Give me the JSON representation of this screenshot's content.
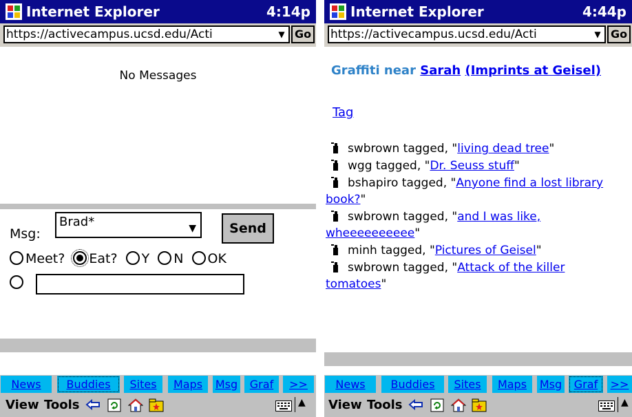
{
  "left_screen": {
    "title": "Internet Explorer",
    "clock": "4:14p",
    "url": "https://activecampus.ucsd.edu/Acti",
    "go_label": "Go",
    "status": "No Messages",
    "msg_label": "Msg:",
    "msg_recipient": "Brad*",
    "send_label": "Send",
    "radio_options": [
      {
        "label": "Meet?",
        "checked": false
      },
      {
        "label": "Eat?",
        "checked": true
      },
      {
        "label": "Y",
        "checked": false
      },
      {
        "label": "N",
        "checked": false
      },
      {
        "label": "OK",
        "checked": false
      }
    ],
    "nav": [
      "News",
      "Buddies",
      "Sites",
      "Maps",
      "Msg",
      "Graf",
      ">>"
    ],
    "nav_active": "Buddies",
    "menu": [
      "View",
      "Tools"
    ]
  },
  "right_screen": {
    "title": "Internet Explorer",
    "clock": "4:44p",
    "url": "https://activecampus.ucsd.edu/Acti",
    "go_label": "Go",
    "heading_prefix": "Graffiti near",
    "heading_person": "Sarah",
    "heading_place": "(Imprints at Geisel)",
    "tag_link": "Tag",
    "tags": [
      {
        "user": "swbrown",
        "text": "living dead tree"
      },
      {
        "user": "wgg",
        "text": "Dr. Seuss stuff"
      },
      {
        "user": "bshapiro",
        "text": "Anyone find a lost library book?"
      },
      {
        "user": "swbrown",
        "text": "and I was like, wheeeeeeeeee"
      },
      {
        "user": "minh",
        "text": "Pictures of Geisel"
      },
      {
        "user": "swbrown",
        "text": "Attack of the killer tomatoes"
      }
    ],
    "tagged_word": "tagged,",
    "nav": [
      "News",
      "Buddies",
      "Sites",
      "Maps",
      "Msg",
      "Graf",
      ">>"
    ],
    "nav_active": "Graf",
    "menu": [
      "View",
      "Tools"
    ]
  },
  "colors": {
    "titlebar": "#0a0a8c",
    "nav_tab": "#00b7ef",
    "link": "#0000ee",
    "heading": "#2e82c8",
    "chrome": "#c0c0c0"
  },
  "icons": [
    "windows-flag-icon",
    "dropdown-arrow-icon",
    "back-arrow-icon",
    "refresh-icon",
    "home-icon",
    "favorites-icon",
    "keyboard-icon",
    "up-arrow-icon",
    "spray-can-icon"
  ]
}
